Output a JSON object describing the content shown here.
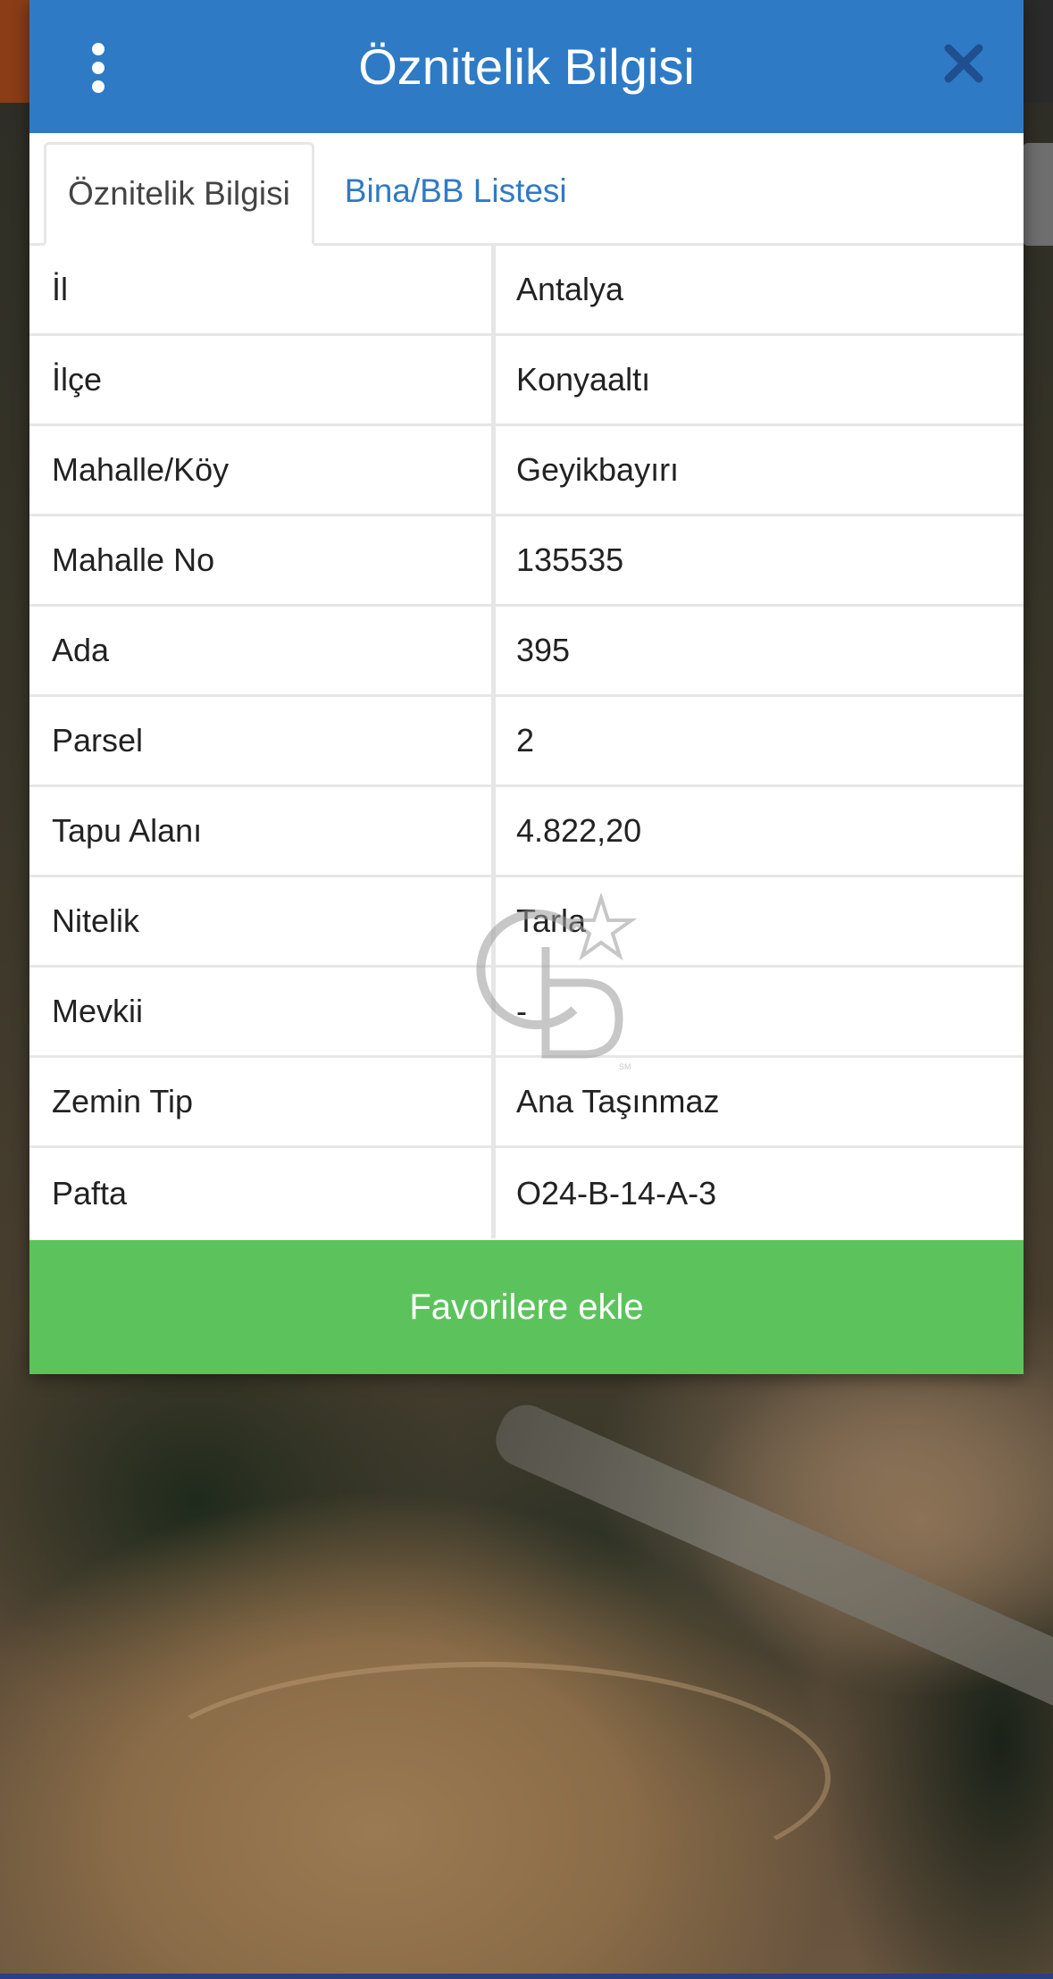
{
  "header": {
    "title": "Öznitelik Bilgisi",
    "menu_icon": "vertical-dots-icon",
    "close_icon": "close-icon"
  },
  "tabs": [
    {
      "label": "Öznitelik Bilgisi",
      "active": true
    },
    {
      "label": "Bina/BB Listesi",
      "active": false
    }
  ],
  "attributes": [
    {
      "label": "İl",
      "value": "Antalya"
    },
    {
      "label": "İlçe",
      "value": "Konyaaltı"
    },
    {
      "label": "Mahalle/Köy",
      "value": "Geyikbayırı"
    },
    {
      "label": "Mahalle No",
      "value": "135535"
    },
    {
      "label": "Ada",
      "value": "395"
    },
    {
      "label": "Parsel",
      "value": "2"
    },
    {
      "label": "Tapu Alanı",
      "value": "4.822,20"
    },
    {
      "label": "Nitelik",
      "value": "Tarla"
    },
    {
      "label": "Mevkii",
      "value": "-"
    },
    {
      "label": "Zemin Tip",
      "value": "Ana Taşınmaz"
    },
    {
      "label": "Pafta",
      "value": "O24-B-14-A-3"
    }
  ],
  "actions": {
    "favorite_label": "Favorilere ekle"
  },
  "watermark": {
    "text": "CB",
    "icon": "star-logo-watermark"
  },
  "colors": {
    "header_blue": "#2f7ac5",
    "tab_link_blue": "#2f7ac5",
    "favorite_green": "#5cc35c"
  }
}
